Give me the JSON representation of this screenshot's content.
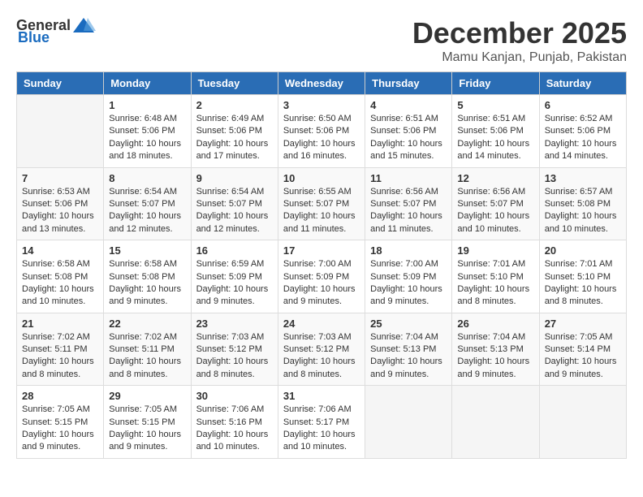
{
  "app": {
    "logo_general": "General",
    "logo_blue": "Blue",
    "title": "December 2025",
    "subtitle": "Mamu Kanjan, Punjab, Pakistan"
  },
  "calendar": {
    "headers": [
      "Sunday",
      "Monday",
      "Tuesday",
      "Wednesday",
      "Thursday",
      "Friday",
      "Saturday"
    ],
    "weeks": [
      [
        {
          "date": "",
          "info": ""
        },
        {
          "date": "1",
          "info": "Sunrise: 6:48 AM\nSunset: 5:06 PM\nDaylight: 10 hours\nand 18 minutes."
        },
        {
          "date": "2",
          "info": "Sunrise: 6:49 AM\nSunset: 5:06 PM\nDaylight: 10 hours\nand 17 minutes."
        },
        {
          "date": "3",
          "info": "Sunrise: 6:50 AM\nSunset: 5:06 PM\nDaylight: 10 hours\nand 16 minutes."
        },
        {
          "date": "4",
          "info": "Sunrise: 6:51 AM\nSunset: 5:06 PM\nDaylight: 10 hours\nand 15 minutes."
        },
        {
          "date": "5",
          "info": "Sunrise: 6:51 AM\nSunset: 5:06 PM\nDaylight: 10 hours\nand 14 minutes."
        },
        {
          "date": "6",
          "info": "Sunrise: 6:52 AM\nSunset: 5:06 PM\nDaylight: 10 hours\nand 14 minutes."
        }
      ],
      [
        {
          "date": "7",
          "info": "Sunrise: 6:53 AM\nSunset: 5:06 PM\nDaylight: 10 hours\nand 13 minutes."
        },
        {
          "date": "8",
          "info": "Sunrise: 6:54 AM\nSunset: 5:07 PM\nDaylight: 10 hours\nand 12 minutes."
        },
        {
          "date": "9",
          "info": "Sunrise: 6:54 AM\nSunset: 5:07 PM\nDaylight: 10 hours\nand 12 minutes."
        },
        {
          "date": "10",
          "info": "Sunrise: 6:55 AM\nSunset: 5:07 PM\nDaylight: 10 hours\nand 11 minutes."
        },
        {
          "date": "11",
          "info": "Sunrise: 6:56 AM\nSunset: 5:07 PM\nDaylight: 10 hours\nand 11 minutes."
        },
        {
          "date": "12",
          "info": "Sunrise: 6:56 AM\nSunset: 5:07 PM\nDaylight: 10 hours\nand 10 minutes."
        },
        {
          "date": "13",
          "info": "Sunrise: 6:57 AM\nSunset: 5:08 PM\nDaylight: 10 hours\nand 10 minutes."
        }
      ],
      [
        {
          "date": "14",
          "info": "Sunrise: 6:58 AM\nSunset: 5:08 PM\nDaylight: 10 hours\nand 10 minutes."
        },
        {
          "date": "15",
          "info": "Sunrise: 6:58 AM\nSunset: 5:08 PM\nDaylight: 10 hours\nand 9 minutes."
        },
        {
          "date": "16",
          "info": "Sunrise: 6:59 AM\nSunset: 5:09 PM\nDaylight: 10 hours\nand 9 minutes."
        },
        {
          "date": "17",
          "info": "Sunrise: 7:00 AM\nSunset: 5:09 PM\nDaylight: 10 hours\nand 9 minutes."
        },
        {
          "date": "18",
          "info": "Sunrise: 7:00 AM\nSunset: 5:09 PM\nDaylight: 10 hours\nand 9 minutes."
        },
        {
          "date": "19",
          "info": "Sunrise: 7:01 AM\nSunset: 5:10 PM\nDaylight: 10 hours\nand 8 minutes."
        },
        {
          "date": "20",
          "info": "Sunrise: 7:01 AM\nSunset: 5:10 PM\nDaylight: 10 hours\nand 8 minutes."
        }
      ],
      [
        {
          "date": "21",
          "info": "Sunrise: 7:02 AM\nSunset: 5:11 PM\nDaylight: 10 hours\nand 8 minutes."
        },
        {
          "date": "22",
          "info": "Sunrise: 7:02 AM\nSunset: 5:11 PM\nDaylight: 10 hours\nand 8 minutes."
        },
        {
          "date": "23",
          "info": "Sunrise: 7:03 AM\nSunset: 5:12 PM\nDaylight: 10 hours\nand 8 minutes."
        },
        {
          "date": "24",
          "info": "Sunrise: 7:03 AM\nSunset: 5:12 PM\nDaylight: 10 hours\nand 8 minutes."
        },
        {
          "date": "25",
          "info": "Sunrise: 7:04 AM\nSunset: 5:13 PM\nDaylight: 10 hours\nand 9 minutes."
        },
        {
          "date": "26",
          "info": "Sunrise: 7:04 AM\nSunset: 5:13 PM\nDaylight: 10 hours\nand 9 minutes."
        },
        {
          "date": "27",
          "info": "Sunrise: 7:05 AM\nSunset: 5:14 PM\nDaylight: 10 hours\nand 9 minutes."
        }
      ],
      [
        {
          "date": "28",
          "info": "Sunrise: 7:05 AM\nSunset: 5:15 PM\nDaylight: 10 hours\nand 9 minutes."
        },
        {
          "date": "29",
          "info": "Sunrise: 7:05 AM\nSunset: 5:15 PM\nDaylight: 10 hours\nand 9 minutes."
        },
        {
          "date": "30",
          "info": "Sunrise: 7:06 AM\nSunset: 5:16 PM\nDaylight: 10 hours\nand 10 minutes."
        },
        {
          "date": "31",
          "info": "Sunrise: 7:06 AM\nSunset: 5:17 PM\nDaylight: 10 hours\nand 10 minutes."
        },
        {
          "date": "",
          "info": ""
        },
        {
          "date": "",
          "info": ""
        },
        {
          "date": "",
          "info": ""
        }
      ]
    ]
  }
}
